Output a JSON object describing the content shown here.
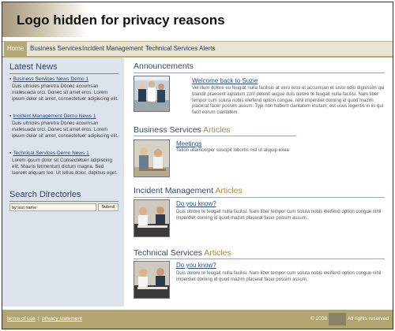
{
  "header": {
    "logo_text": "Logo hidden for privacy reasons"
  },
  "nav": {
    "items": [
      {
        "label": "Home",
        "active": true
      },
      {
        "label": "Business Services",
        "active": false
      },
      {
        "label": "Incident Management",
        "active": false
      },
      {
        "label": "Technical Services",
        "active": false
      },
      {
        "label": "Alerts",
        "active": false
      }
    ]
  },
  "sidebar": {
    "latest_news_title": "Latest News",
    "news": [
      {
        "link": "Business Services News Demo 1",
        "text": "Duis ultricies pharetra Donec accumsan malesuada orci. Donec sit amet eros. Lorem ipsum dolor sit amet, consectetuer adipiscing elit."
      },
      {
        "link": "Incident Management Demo News 1",
        "text": "Duis ultricies pharetra Donec accumsan malesuada orci. Donec sit amet eros. Lorem ipsum dolor sit amet, consectetuer adipiscing elit."
      },
      {
        "link": "Technical Services Demo News 1",
        "text": "Lorem ipsum dolor sit Consectetuer adipiscing elit. Mauris fermentum dictum magna. Sed laoreet aliquam leo. Ut tellus dolor, dapibus eget."
      }
    ],
    "search_title": "Search Directories",
    "search_value": "by last name",
    "search_button": "Submit"
  },
  "main": {
    "sections": [
      {
        "title": "Announcements",
        "accent": "",
        "heading": "Welcome back to Suzie",
        "body": "Vel illum dolore eu feugiat nulla facilisis at vero eros et accumsan et iusto odio dignissim qui blandit praesent luptatum zzril delenit augue duis dolore te feugait nulla facilisi. Nam liber tempor cum soluta nobis eleifend option congue. nihil imperdiet doming id quod mazim placerat facer possim assum. Typi non habent claritatem insitam; est usus legentis in iis qui facit eorum claritatem."
      },
      {
        "title": "Business Services ",
        "accent": "Articles",
        "heading": "Meetings",
        "body": "Tation ullamcorper suscipit lobortis nisl ut aliquip exea"
      },
      {
        "title": "Incident Management ",
        "accent": "Articles",
        "heading": "Do you know?",
        "body": "Duis dolore te feugait nulla facilisi. Nam liber tempor cum soluta nobis eleifend option congue nihil imperdiet doming id quod mazim placerat facer possim assum."
      },
      {
        "title": "Technical Services ",
        "accent": "Articles",
        "heading": "Do you know?",
        "body": "Duis dolore te feugait nulla facilisi. Nam liber tempor cum soluta nobis eleifend option congue nihil imperdiet doming id quod mazim placerat facer possim assum."
      }
    ]
  },
  "footer": {
    "terms": "terms of use",
    "separator": "|",
    "privacy": "privacy statement",
    "copyright_year": "© 2008",
    "rights": "All rights reserved"
  },
  "colors": {
    "nav_active": "#b5a877",
    "footer": "#b3a56f",
    "sidebar": "#dde3ea",
    "heading": "#34496e",
    "accent": "#a8893f"
  }
}
